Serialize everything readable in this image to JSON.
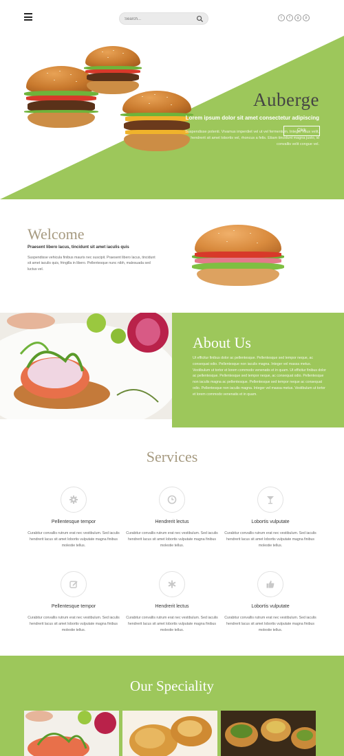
{
  "header": {
    "search_placeholder": "Search...",
    "social": [
      {
        "icon": "twitter-icon",
        "glyph": "t"
      },
      {
        "icon": "facebook-icon",
        "glyph": "f"
      },
      {
        "icon": "google-plus-icon",
        "glyph": "g"
      },
      {
        "icon": "pinterest-icon",
        "glyph": "p"
      }
    ]
  },
  "hero": {
    "title": "Auberge",
    "subtitle": "Lorem ipsum dolor sit amet consectetur adipiscing",
    "description": "Suspendisse potenti. Vivamus imperdiet vel ut vel fermentum. Integer risus velit, hendrerit sit amet lobortis vel, rhoncus a felis. Etiam tincidunt magna justo, id convallis velit congue vel.",
    "button": "Click"
  },
  "welcome": {
    "title": "Welcome",
    "lead": "Praesent libero lacus, tincidunt sit amet iaculis quis",
    "body": "Suspendisse vehicula finibus mauris nec suscipit. Praesent libero lacus, tincidunt sit amet iaculis quis, fringilla in libero. Pellentesque nunc nibh, malesuada sed luctus vel."
  },
  "about": {
    "title": "About Us",
    "body": "Ut efficitur finibus dolor ac pellentesque. Pellentesque sed tempor neque, ac consequat odio. Pellentesque non iaculis magna. Integer vel massa metus. Vestibulum ut tortor et lorem commodo venenatis et in quam. Ut efficitur finibus dolor ac pellentesque. Pellentesque sed tempor neque, ac consequat odio. Pellentesque non iaculis magna ac pellentesque. Pellentesque sed tempor neque ac consequat odio. Pellentesque non iaculis magna. Integer vel massa metus. Vestibulum ut tortor et lorem commodo venenatis et in quam."
  },
  "services": {
    "title": "Services",
    "items": [
      {
        "icon": "gear-icon",
        "name": "Pellentesque tempor",
        "desc": "Curabitur convallis rutrum erat nec vestibulum. Sed iaculis hendrerit lacus sit amet lobortis vulputate magna finibus molestie tellus."
      },
      {
        "icon": "clock-icon",
        "name": "Hendrerit lectus",
        "desc": "Curabitur convallis rutrum erat nec vestibulum. Sed iaculis hendrerit lacus sit amet lobortis vulputate magna finibus molestie tellus."
      },
      {
        "icon": "cocktail-glass-icon",
        "name": "Lobortis vulputate",
        "desc": "Curabitur convallis rutrum erat nec vestibulum. Sed iaculis hendrerit lacus sit amet lobortis vulputate magna finibus molestie tellus."
      },
      {
        "icon": "edit-icon",
        "name": "Pellentesque tempor",
        "desc": "Curabitur convallis rutrum erat nec vestibulum. Sed iaculis hendrerit lacus sit amet lobortis vulputate magna finibus molestie tellus."
      },
      {
        "icon": "asterisk-icon",
        "name": "Hendrerit lectus",
        "desc": "Curabitur convallis rutrum erat nec vestibulum. Sed iaculis hendrerit lacus sit amet lobortis vulputate magna finibus molestie tellus."
      },
      {
        "icon": "thumbs-up-icon",
        "name": "Lobortis vulputate",
        "desc": "Curabitur convallis rutrum erat nec vestibulum. Sed iaculis hendrerit lacus sit amet lobortis vulputate magna finibus molestie tellus."
      }
    ]
  },
  "speciality": {
    "title": "Our Speciality"
  },
  "colors": {
    "accent_green": "#9dc75b",
    "title_taupe": "#a69a80"
  }
}
